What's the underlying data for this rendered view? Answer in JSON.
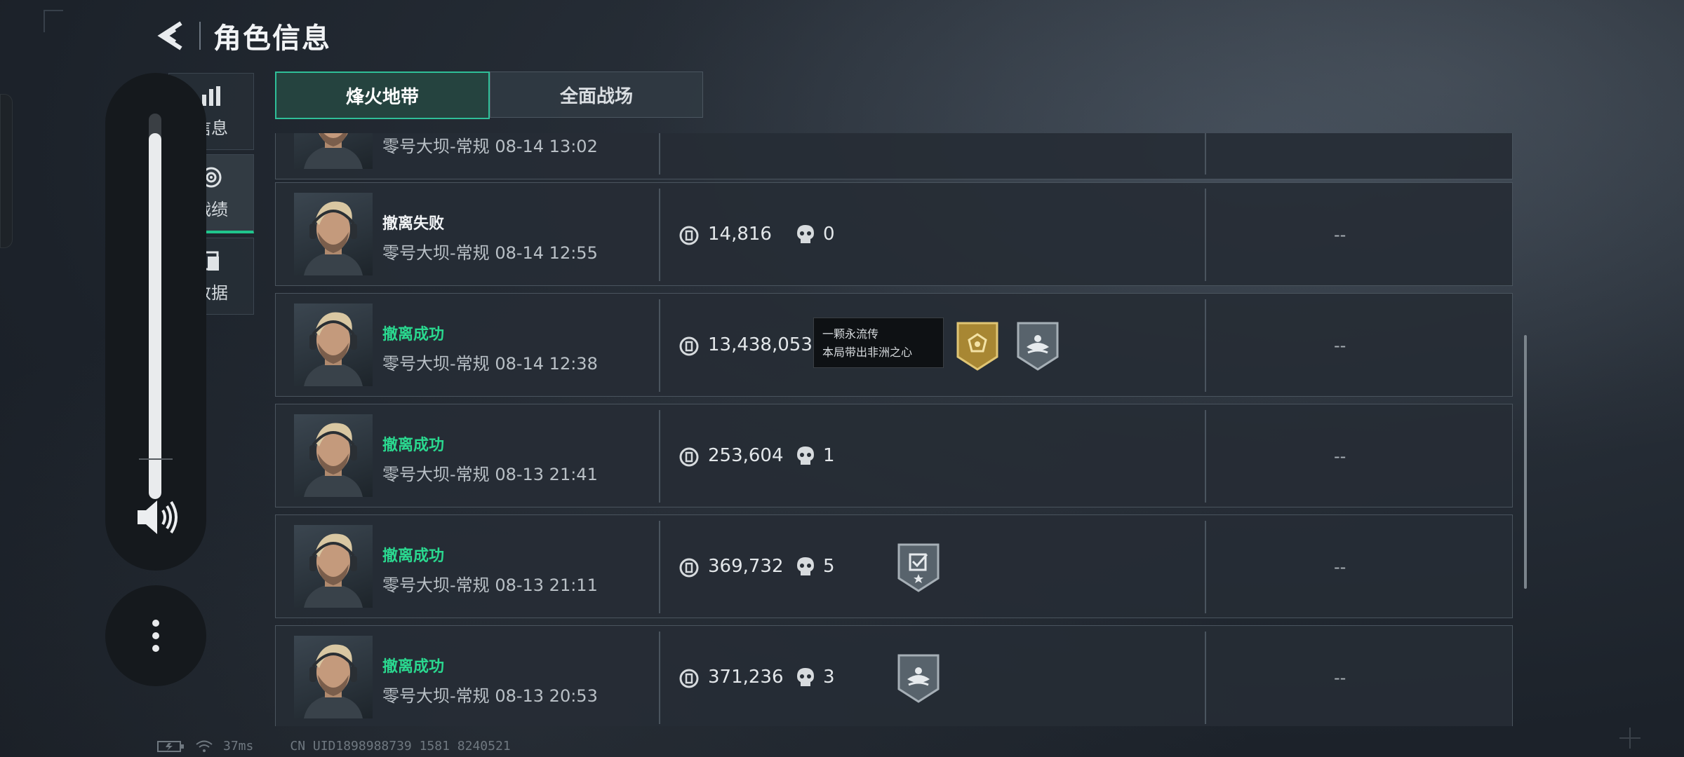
{
  "header": {
    "title": "角色信息",
    "back_icon": "back-arrow-icon"
  },
  "side_tabs": [
    {
      "label": "信息",
      "icon": "bar-chart-icon",
      "active": false
    },
    {
      "label": "战绩",
      "icon": "target-icon",
      "active": true
    },
    {
      "label": "数据",
      "icon": "document-icon",
      "active": false
    }
  ],
  "mode_tabs": [
    {
      "label": "烽火地带",
      "active": true
    },
    {
      "label": "全面战场",
      "active": false
    }
  ],
  "records": [
    {
      "status": "",
      "status_type": "fail",
      "map": "零号大坝-常规",
      "time": "08-14 13:02",
      "value": "",
      "kills": "",
      "result_col": ""
    },
    {
      "status": "撤离失败",
      "status_type": "fail",
      "map": "零号大坝-常规",
      "time": "08-14 12:55",
      "value": "14,816",
      "kills": "0",
      "result_col": "--"
    },
    {
      "status": "撤离成功",
      "status_type": "ok",
      "map": "零号大坝-常规",
      "time": "08-14 12:38",
      "value": "13,438,053",
      "kills": "",
      "result_col": "--",
      "tooltip": {
        "line1": "一颗永流传",
        "line2": "本局带出非洲之心"
      },
      "badges": [
        "gold-heart-badge-icon",
        "silver-rescue-badge-icon"
      ]
    },
    {
      "status": "撤离成功",
      "status_type": "ok",
      "map": "零号大坝-常规",
      "time": "08-13 21:41",
      "value": "253,604",
      "kills": "1",
      "result_col": "--"
    },
    {
      "status": "撤离成功",
      "status_type": "ok",
      "map": "零号大坝-常规",
      "time": "08-13 21:11",
      "value": "369,732",
      "kills": "5",
      "result_col": "--",
      "badges": [
        "silver-task-badge-icon"
      ]
    },
    {
      "status": "撤离成功",
      "status_type": "ok",
      "map": "零号大坝-常规",
      "time": "08-13 20:53",
      "value": "371,236",
      "kills": "3",
      "result_col": "--",
      "badges": [
        "silver-rescue-badge-icon"
      ]
    }
  ],
  "volume": {
    "level": 0.95
  },
  "footer": {
    "ping": "37ms",
    "uid": "CN UID1898988739 1581 8240521"
  },
  "colors": {
    "accent": "#2fbf98",
    "success": "#2ad88f",
    "gold": "#b8963a"
  }
}
